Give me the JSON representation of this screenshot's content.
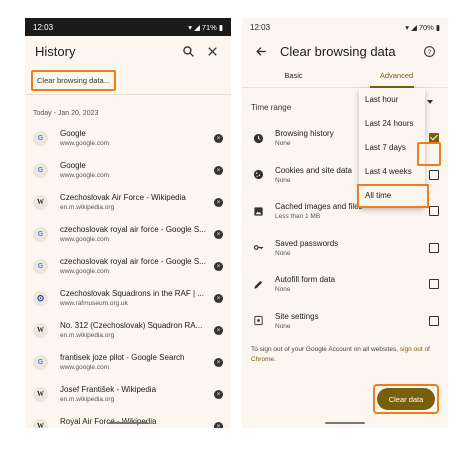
{
  "left": {
    "status": {
      "time": "12:03",
      "battery": "71%"
    },
    "title": "History",
    "clear_chip": "Clear browsing data...",
    "date_header": "Today - Jan 20, 2023",
    "items": [
      {
        "favicon": "G",
        "type": "g",
        "title": "Google",
        "url": "www.google.com"
      },
      {
        "favicon": "G",
        "type": "g",
        "title": "Google",
        "url": "www.google.com"
      },
      {
        "favicon": "W",
        "type": "w",
        "title": "Czechoslovak Air Force - Wikipedia",
        "url": "en.m.wikipedia.org"
      },
      {
        "favicon": "G",
        "type": "g",
        "title": "czechoslovak royal air force - Google S...",
        "url": "www.google.com"
      },
      {
        "favicon": "G",
        "type": "g",
        "title": "czechoslovak royal air force - Google S...",
        "url": "www.google.com"
      },
      {
        "favicon": "⊙",
        "type": "r",
        "title": "Czechoslovak Squadrons in the RAF | ...",
        "url": "www.rafmuseum.org.uk"
      },
      {
        "favicon": "W",
        "type": "w",
        "title": "No. 312 (Czechoslovak) Squadron RA...",
        "url": "en.m.wikipedia.org"
      },
      {
        "favicon": "G",
        "type": "g",
        "title": "frantisek joze pilot - Google Search",
        "url": "www.google.com"
      },
      {
        "favicon": "W",
        "type": "w",
        "title": "Josef František - Wikipedia",
        "url": "en.m.wikipedia.org"
      },
      {
        "favicon": "W",
        "type": "w",
        "title": "Royal Air Force - Wikipedia",
        "url": "en.m.wikipedia.org"
      }
    ]
  },
  "right": {
    "status": {
      "time": "12:03",
      "battery": "70%"
    },
    "title": "Clear browsing data",
    "tabs": [
      "Basic",
      "Advanced"
    ],
    "active_tab": "Advanced",
    "time_range_label": "Time range",
    "time_range_options": [
      "Last hour",
      "Last 24 hours",
      "Last 7 days",
      "Last 4 weeks",
      "All time"
    ],
    "selected_range": "All time",
    "options": [
      {
        "icon": "clock-icon",
        "title": "Browsing history",
        "sub": "None",
        "checked": true
      },
      {
        "icon": "cookie-icon",
        "title": "Cookies and site data",
        "sub": "None",
        "checked": false
      },
      {
        "icon": "image-icon",
        "title": "Cached images and files",
        "sub": "Less than 1 MB",
        "checked": false
      },
      {
        "icon": "key-icon",
        "title": "Saved passwords",
        "sub": "None",
        "checked": false
      },
      {
        "icon": "pencil-icon",
        "title": "Autofill form data",
        "sub": "None",
        "checked": false
      },
      {
        "icon": "site-settings-icon",
        "title": "Site settings",
        "sub": "None",
        "checked": false
      }
    ],
    "signout_text": "To sign out of your Google Account on all websites, ",
    "signout_link": "sign out of Chrome.",
    "clear_button": "Clear data"
  },
  "colors": {
    "accent": "#785f0c",
    "highlight": "#f07d1a",
    "background": "#fbf7f0"
  }
}
